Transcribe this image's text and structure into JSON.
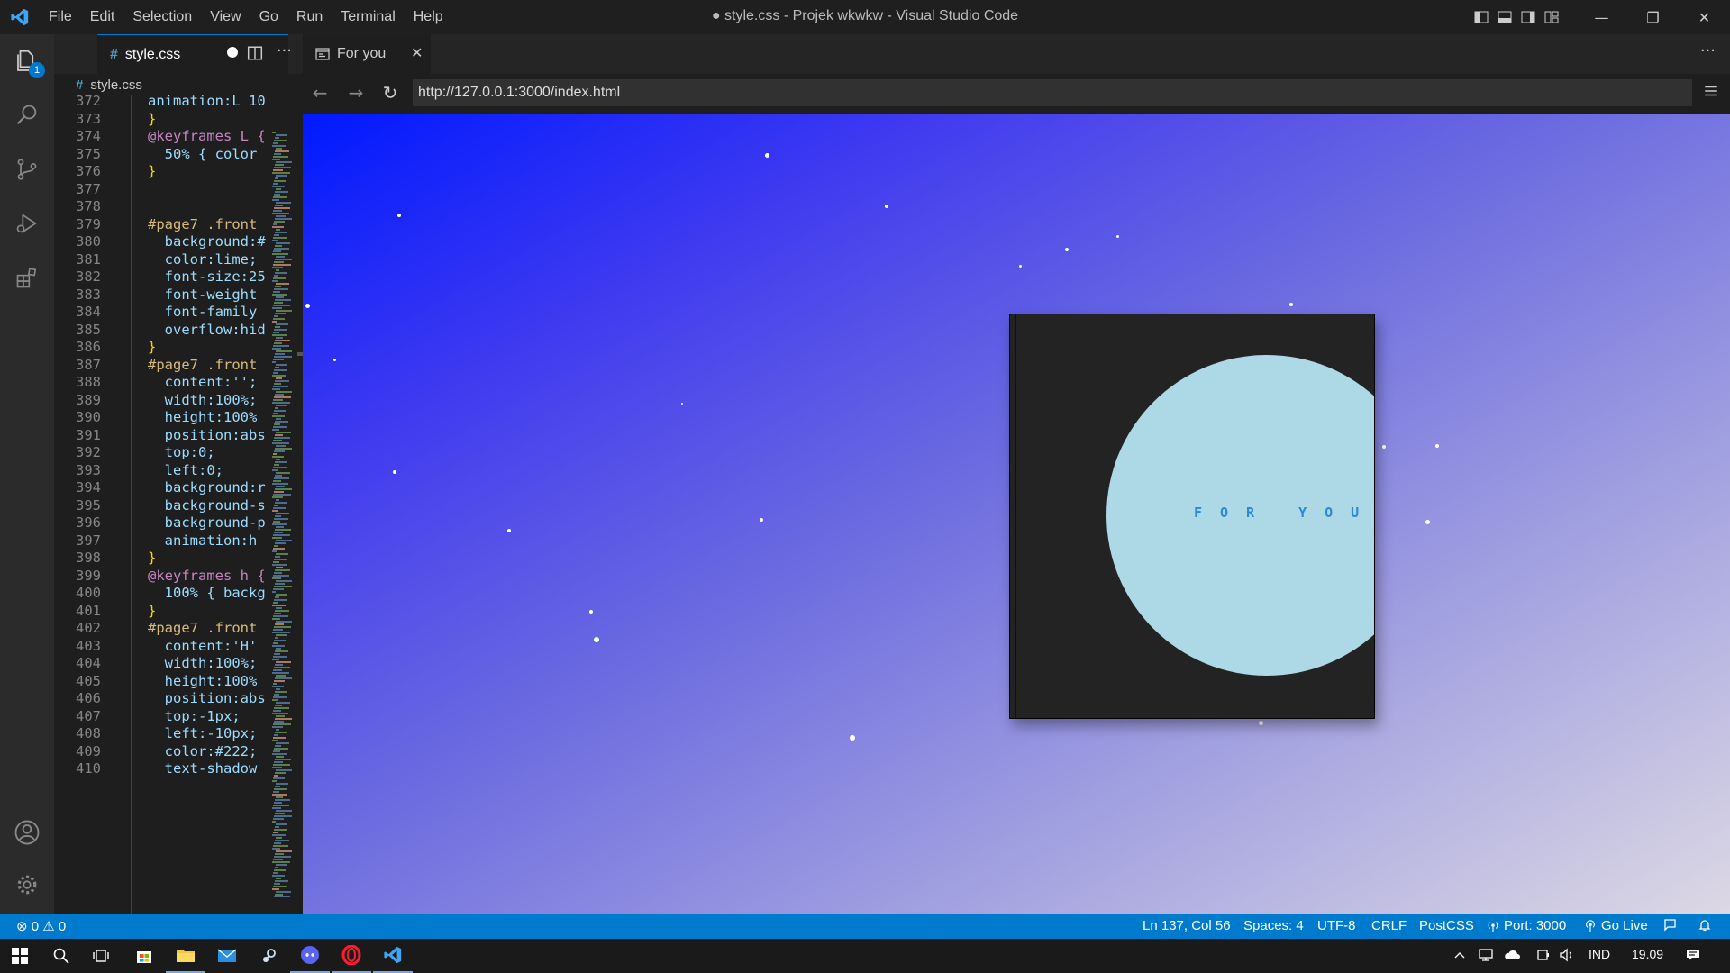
{
  "titlebar": {
    "menu": [
      "File",
      "Edit",
      "Selection",
      "View",
      "Go",
      "Run",
      "Terminal",
      "Help"
    ],
    "window_title": "● style.css - Projek wkwkw - Visual Studio Code",
    "minimize": "—",
    "restore": "❐",
    "close": "✕"
  },
  "activitybar": {
    "explorer_badge": "1"
  },
  "editor": {
    "tab_label": "style.css",
    "tab_icon": "#",
    "tab_more": "···",
    "breadcrumb": "style.css",
    "lines": [
      {
        "num": "372",
        "code": "animation:L 10"
      },
      {
        "num": "373",
        "code": "}"
      },
      {
        "num": "374",
        "code": "@keyframes L {"
      },
      {
        "num": "375",
        "code": "  50% { color"
      },
      {
        "num": "376",
        "code": "}"
      },
      {
        "num": "377",
        "code": ""
      },
      {
        "num": "378",
        "code": ""
      },
      {
        "num": "379",
        "code": "#page7 .front"
      },
      {
        "num": "380",
        "code": "  background:#"
      },
      {
        "num": "381",
        "code": "  color:lime;"
      },
      {
        "num": "382",
        "code": "  font-size:25"
      },
      {
        "num": "383",
        "code": "  font-weight"
      },
      {
        "num": "384",
        "code": "  font-family"
      },
      {
        "num": "385",
        "code": "  overflow:hid"
      },
      {
        "num": "386",
        "code": "}"
      },
      {
        "num": "387",
        "code": "#page7 .front"
      },
      {
        "num": "388",
        "code": "  content:'';"
      },
      {
        "num": "389",
        "code": "  width:100%;"
      },
      {
        "num": "390",
        "code": "  height:100%"
      },
      {
        "num": "391",
        "code": "  position:abs"
      },
      {
        "num": "392",
        "code": "  top:0;"
      },
      {
        "num": "393",
        "code": "  left:0;"
      },
      {
        "num": "394",
        "code": "  background:r"
      },
      {
        "num": "395",
        "code": "  background-s"
      },
      {
        "num": "396",
        "code": "  background-p"
      },
      {
        "num": "397",
        "code": "  animation:h"
      },
      {
        "num": "398",
        "code": "}"
      },
      {
        "num": "399",
        "code": "@keyframes h {"
      },
      {
        "num": "400",
        "code": "  100% { backg"
      },
      {
        "num": "401",
        "code": "}"
      },
      {
        "num": "402",
        "code": "#page7 .front"
      },
      {
        "num": "403",
        "code": "  content:'H'"
      },
      {
        "num": "404",
        "code": "  width:100%;"
      },
      {
        "num": "405",
        "code": "  height:100%"
      },
      {
        "num": "406",
        "code": "  position:abs"
      },
      {
        "num": "407",
        "code": "  top:-1px;"
      },
      {
        "num": "408",
        "code": "  left:-10px;"
      },
      {
        "num": "409",
        "code": "  color:#222;"
      },
      {
        "num": "410",
        "code": "  text-shadow"
      }
    ]
  },
  "browser": {
    "tab_label": "For you",
    "tab_close": "✕",
    "more": "···",
    "back": "←",
    "forward": "→",
    "reload": "↻",
    "url": "http://127.0.0.1:3000/index.html",
    "card_text": "FOR YOU"
  },
  "statusbar": {
    "problems": "⊗ 0 ⚠ 0",
    "position": "Ln 137, Col 56",
    "spaces": "Spaces: 4",
    "encoding": "UTF-8",
    "eol": "CRLF",
    "language": "PostCSS",
    "port": "Port: 3000",
    "golive": "Go Live"
  },
  "taskbar": {
    "language": "IND",
    "time": "19.09"
  },
  "colors": {
    "accent": "#007acc",
    "card_bg": "#232323",
    "moon": "#add8e6",
    "card_text": "#2a8ad8"
  }
}
